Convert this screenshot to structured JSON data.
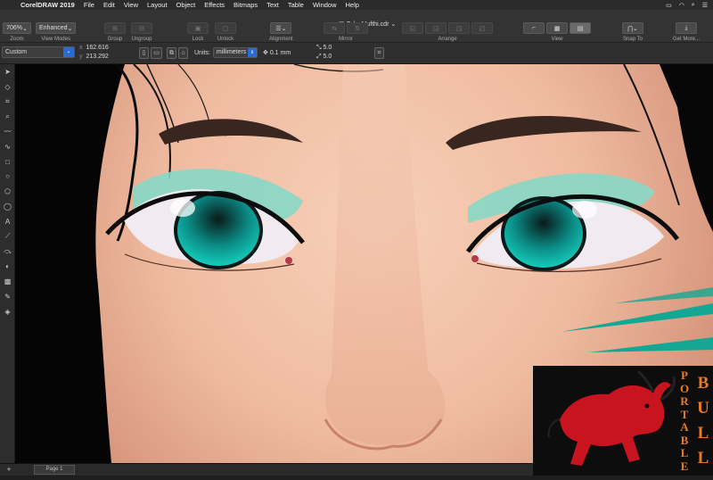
{
  "menubar": {
    "app": "CorelDRAW 2019",
    "items": [
      "File",
      "Edit",
      "View",
      "Layout",
      "Object",
      "Effects",
      "Bitmaps",
      "Text",
      "Table",
      "Window",
      "Help"
    ]
  },
  "window": {
    "title": "Zaky Mufthi.cdr"
  },
  "toolbar": {
    "zoom_value": "706%",
    "zoom_label": "Zoom",
    "view_mode_value": "Enhanced",
    "view_mode_label": "View Modes",
    "group_label": "Group",
    "ungroup_label": "Ungroup",
    "lock_label": "Lock",
    "unlock_label": "Unlock",
    "alignment_label": "Alignment",
    "mirror_label": "Mirror",
    "arrange_label": "Arrange",
    "view_label": "View",
    "snap_label": "Snap To",
    "getmore_label": "Get More..."
  },
  "property_bar": {
    "preset": "Custom",
    "x_value": "162.616",
    "y_value": "213.292",
    "units_label": "Units:",
    "units_value": "millimeters",
    "nudge_value": "0.1 mm",
    "dup_x": "5.0",
    "dup_y": "5.0"
  },
  "status": {
    "page_tab": "Page 1"
  },
  "watermark": {
    "word1": "PORTABLE",
    "word2": "BULL"
  },
  "colors": {
    "accent": "#2a6bd2",
    "iris": "#13b8a8",
    "eyeshadow": "#86d8c6",
    "skin": "#f3c2a7",
    "watermark": "#e87a22"
  }
}
